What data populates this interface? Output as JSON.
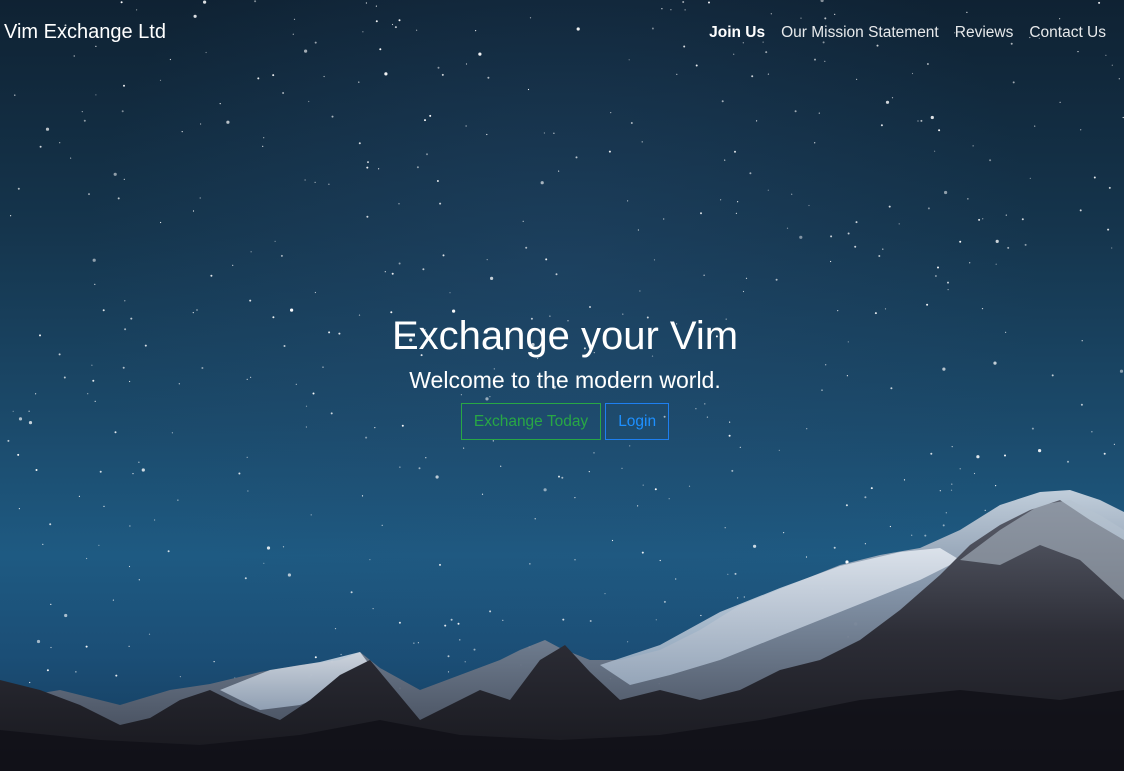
{
  "colors": {
    "sky_top": "#0f2233",
    "sky_bottom": "#1e5a82",
    "success": "#28a745",
    "primary": "#1e7ff0",
    "text": "#ffffff"
  },
  "navbar": {
    "brand": "Vim Exchange Ltd",
    "links": [
      {
        "label": "Join Us",
        "active": true
      },
      {
        "label": "Our Mission Statement",
        "active": false
      },
      {
        "label": "Reviews",
        "active": false
      },
      {
        "label": "Contact Us",
        "active": false
      }
    ]
  },
  "hero": {
    "title": "Exchange your Vim",
    "subtitle": "Welcome to the modern world.",
    "buttons": {
      "exchange_label": "Exchange Today",
      "login_label": "Login"
    }
  },
  "background": {
    "description_icon": "night-sky-mountains-image"
  }
}
